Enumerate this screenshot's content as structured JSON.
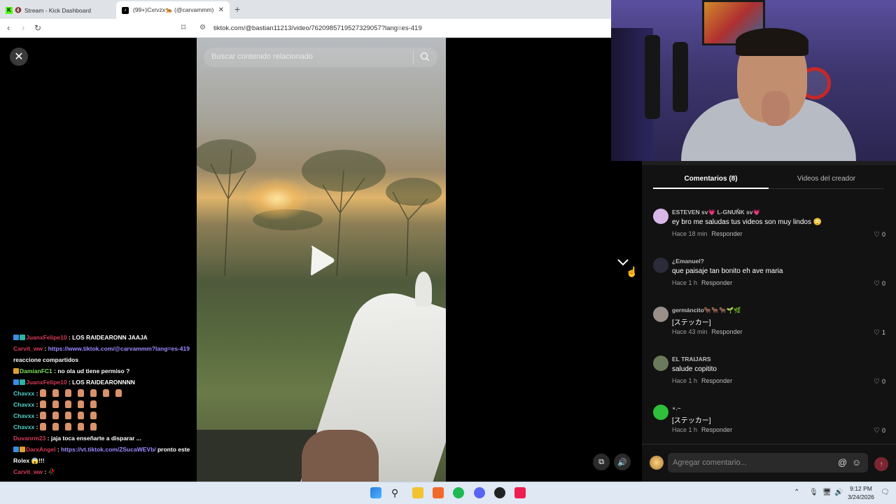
{
  "browser": {
    "tabs": [
      {
        "title": "Stream - Kick Dashboard",
        "active": false
      },
      {
        "title": "(99+)Cxrvzx🐅 (@carvammm) | ",
        "active": true
      }
    ],
    "new_tab_label": "+",
    "url": "tiktok.com/@bastian11213/video/7620985719527329057?lang=es-419"
  },
  "video": {
    "search_placeholder": "Buscar contenido relacionado"
  },
  "chat": {
    "messages": [
      {
        "user": "JuanxFelipe10",
        "user_color": "#d63a5a",
        "badges": [
          "b-blue",
          "b-teal"
        ],
        "text": " : LOS RAIDEARONN JAAJA"
      },
      {
        "user": "Carvit_ww",
        "user_color": "#d63a5a",
        "badges": [],
        "text": " : ",
        "link": "https://www.tiktok.com/@carvammm?lang=es-419",
        "text2": " reaccione compartidos"
      },
      {
        "user": "DamianFC1",
        "user_color": "#7ee05a",
        "badges": [
          "b-gold"
        ],
        "text": " : no ola ud tiene permiso ?"
      },
      {
        "user": "JuanxFelipe10",
        "user_color": "#d63a5a",
        "badges": [
          "b-blue",
          "b-teal"
        ],
        "text": " : LOS RAIDEARONNNN"
      },
      {
        "user": "Chavxx",
        "user_color": "#4fd0c8",
        "badges": [],
        "text": " : ",
        "emotes": 7
      },
      {
        "user": "Chavxx",
        "user_color": "#4fd0c8",
        "badges": [],
        "text": " : ",
        "emotes": 5
      },
      {
        "user": "Chavxx",
        "user_color": "#4fd0c8",
        "badges": [],
        "text": " : ",
        "emotes": 5
      },
      {
        "user": "Chavxx",
        "user_color": "#4fd0c8",
        "badges": [],
        "text": " : ",
        "emotes": 5
      },
      {
        "user": "Duvanrm23",
        "user_color": "#d63a5a",
        "badges": [],
        "text": " : jaja toca enseñarte a disparar ..."
      },
      {
        "user": "DarxAngel",
        "user_color": "#d63a5a",
        "badges": [
          "b-blue",
          "b-gold"
        ],
        "text": " : ",
        "link": "https://vt.tiktok.com/ZSucaWEVb/",
        "text2": " pronto este Rolex 😱!!!"
      },
      {
        "user": "Carvit_ww",
        "user_color": "#d63a5a",
        "badges": [],
        "text": " : 🥀"
      }
    ]
  },
  "comments_panel": {
    "tab_comments": "Comentarios (8)",
    "tab_creator": "Videos del creador",
    "reply_label": "Responder",
    "comments": [
      {
        "user": "ESTEVEN sv💗 L-GNUÑK sv💗",
        "text": "ey bro me saludas tus videos son muy lindos 😳",
        "time": "Hace 18 min",
        "likes": "0",
        "avatar": "#d9b8e8"
      },
      {
        "user": "¿Emanuel?",
        "text": "que paisaje tan bonito eh ave maria",
        "time": "Hace 1 h",
        "likes": "0",
        "avatar": "#2b2b3a"
      },
      {
        "user": "germáncito🐂🐂🐂🌱🌿",
        "text": "[ステッカー]",
        "time": "Hace 43 min",
        "likes": "1",
        "avatar": "#9a8f88"
      },
      {
        "user": "EL TRAIJARS",
        "text": "salude copitito",
        "time": "Hace 1 h",
        "likes": "0",
        "avatar": "#6b7a5a"
      },
      {
        "user": "⋆.~",
        "text": "[ステッカー]",
        "time": "Hace 1 h",
        "likes": "0",
        "avatar": "#2fbf3a"
      }
    ],
    "input_placeholder": "Agregar comentario..."
  },
  "taskbar": {
    "time": "9:12 PM",
    "date": "3/24/2026"
  }
}
